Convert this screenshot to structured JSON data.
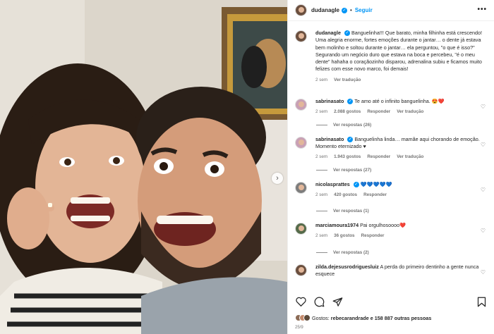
{
  "post": {
    "username": "dudanagle",
    "follow_label": "Seguir",
    "separator": "•",
    "more_label": "•••",
    "next_label": "›"
  },
  "caption": {
    "username": "dudanagle",
    "text": "Banguelinha!!! Que barato, minha filhinha está crescendo! Uma alegria enorme, fortes emoções durante o jantar… o dente já estava bem molinho e soltou durante o jantar… ela perguntou, \"o que é isso?\" Segurando um negócio duro que estava na boca e percebeu, \"é o meu dente\" hahaha o coraçãozinho disparou, adrenalina subiu e ficamos muito felizes com esse novo marco, foi demais!",
    "time": "2 sem",
    "translate": "Ver tradução"
  },
  "comments": [
    {
      "username": "sabrinasato",
      "verified": true,
      "text": "Te amo até o infinito banguelinha. 😍❤️",
      "time": "2 sem",
      "likes": "2.088 gostos",
      "reply": "Responder",
      "translate": "Ver tradução",
      "replies": "Ver respostas (26)"
    },
    {
      "username": "sabrinasato",
      "verified": true,
      "text": "Banguelinha linda… mamãe aqui chorando de emoção. Momento eternizado ♥",
      "time": "2 sem",
      "likes": "1.943 gostos",
      "reply": "Responder",
      "translate": "Ver tradução",
      "replies": "Ver respostas (27)"
    },
    {
      "username": "nicolasprattes",
      "verified": true,
      "text": "💙💙💙💙💙",
      "time": "2 sem",
      "likes": "420 gostos",
      "reply": "Responder",
      "replies": "Ver respostas (1)"
    },
    {
      "username": "marciamoura1974",
      "verified": false,
      "text": "Pai orgulhosoooo❤️",
      "time": "2 sem",
      "likes": "36 gostos",
      "reply": "Responder",
      "replies": "Ver respostas (2)"
    },
    {
      "username": "zilda.dejesusrodriguesluiz",
      "verified": false,
      "text": "A perda do primeiro dentinho a gente nunca esquece"
    }
  ],
  "likes_summary": {
    "prefix": "Gostos:",
    "user": "rebecarandrade",
    "rest": "e 158 887 outras pessoas"
  },
  "date": "25/9",
  "icons": [
    "heart-icon",
    "comment-icon",
    "share-icon",
    "bookmark-icon"
  ],
  "colors": {
    "link": "#0095f6",
    "muted": "#737373",
    "like_red": "#ed4956"
  }
}
